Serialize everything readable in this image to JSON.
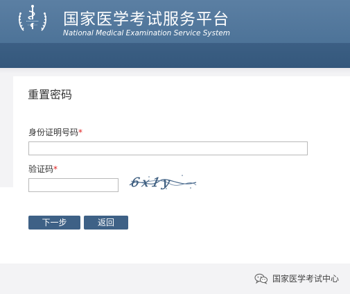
{
  "header": {
    "title": "国家医学考试服务平台",
    "subtitle": "National Medical Examination Service System",
    "logo_icon": "medical-caduceus-emblem-icon",
    "top_color": "#5079a0",
    "bar_color": "#37597d"
  },
  "form": {
    "title": "重置密码",
    "id_label": "身份证明号码",
    "id_required_mark": "*",
    "id_value": "",
    "captcha_label": "验证码",
    "captcha_required_mark": "*",
    "captcha_value": "",
    "captcha_image_text": "6x1y",
    "next_button": "下一步",
    "back_button": "返回"
  },
  "colors": {
    "button_bg": "#3e6186",
    "required_mark": "#e02020",
    "page_bg": "#f3f3f5"
  },
  "watermark": {
    "icon": "wechat-icon",
    "text": "国家医学考试中心"
  }
}
